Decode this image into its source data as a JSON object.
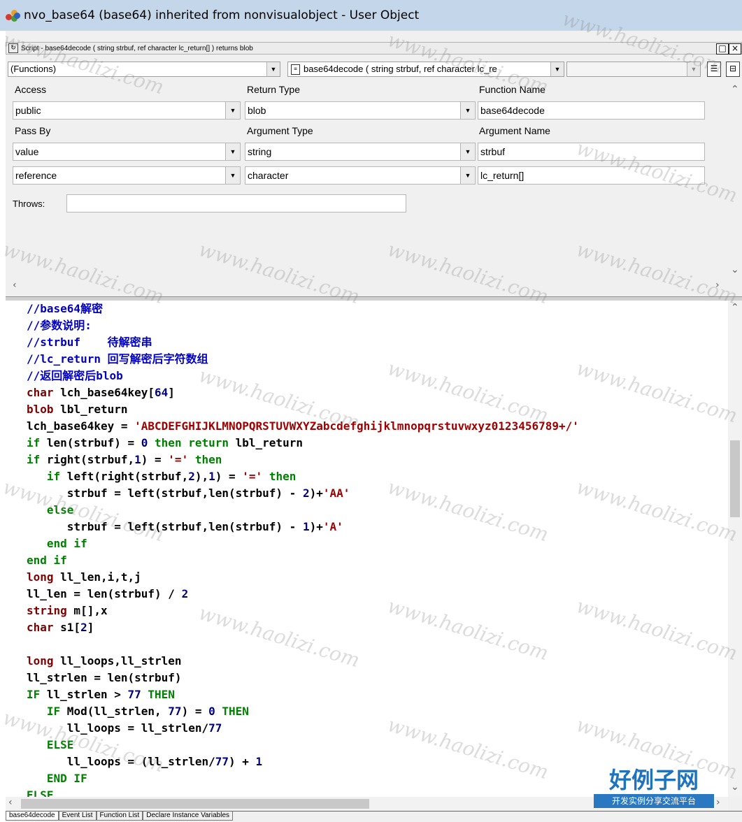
{
  "window": {
    "title": "nvo_base64 (base64) inherited from nonvisualobject - User Object"
  },
  "script_window": {
    "title": "Script - base64decode ( string strbuf, ref character lc_return[] ) returns blob",
    "minimize_label": "□",
    "close_label": "×"
  },
  "toolbar": {
    "category_value": "(Functions)",
    "function_value": "base64decode ( string strbuf, ref character lc_re",
    "third_value": ""
  },
  "prototype": {
    "access_label": "Access",
    "return_type_label": "Return Type",
    "function_name_label": "Function Name",
    "access_value": "public",
    "return_type_value": "blob",
    "function_name_value": "base64decode",
    "pass_by_label": "Pass By",
    "argument_type_label": "Argument Type",
    "argument_name_label": "Argument Name",
    "args": [
      {
        "pass_by": "value",
        "type": "string",
        "name": "strbuf"
      },
      {
        "pass_by": "reference",
        "type": "character",
        "name": "lc_return[]"
      }
    ],
    "throws_label": "Throws:",
    "throws_value": ""
  },
  "code": {
    "line1": "//base64解密",
    "line2": "//参数说明:",
    "line3": "//strbuf    待解密串",
    "line4": "//lc_return 回写解密后字符数组",
    "line5": "//返回解密后blob",
    "l6_kw": "char",
    "l6_rest": " lch_base64key[",
    "l6_num": "64",
    "l6_end": "]",
    "l7_kw": "blob",
    "l7_rest": " lbl_return",
    "l8_pre": "lch_base64key = ",
    "l8_str": "'ABCDEFGHIJKLMNOPQRSTUVWXYZabcdefghijklmnopqrstuvwxyz0123456789+/'",
    "l9_a": "if",
    "l9_b": " len(strbuf) = ",
    "l9_c": "0",
    "l9_d": " then return",
    "l9_e": " lbl_return",
    "l10_a": "if",
    "l10_b": " right(strbuf,",
    "l10_c": "1",
    "l10_d": ") = ",
    "l10_e": "'='",
    "l10_f": " then",
    "l11_a": "   if",
    "l11_b": " left(right(strbuf,",
    "l11_c": "2",
    "l11_d": "),",
    "l11_e": "1",
    "l11_f": ") = ",
    "l11_g": "'='",
    "l11_h": " then",
    "l12_a": "      strbuf = left(strbuf,len(strbuf) - ",
    "l12_b": "2",
    "l12_c": ")+",
    "l12_d": "'AA'",
    "l13_a": "   else",
    "l14_a": "      strbuf = left(strbuf,len(strbuf) - ",
    "l14_b": "1",
    "l14_c": ")+",
    "l14_d": "'A'",
    "l15_a": "   end if",
    "l16_a": "end if",
    "l17_a": "long",
    "l17_b": " ll_len,i,t,j",
    "l18_a": "ll_len = len(strbuf) / ",
    "l18_b": "2",
    "l19_a": "string",
    "l19_b": " m[],x",
    "l20_a": "char",
    "l20_b": " s1[",
    "l20_c": "2",
    "l20_d": "]",
    "l22_a": "long",
    "l22_b": " ll_loops,ll_strlen",
    "l23_a": "ll_strlen = len(strbuf)",
    "l24_a": "IF",
    "l24_b": " ll_strlen > ",
    "l24_c": "77",
    "l24_d": " THEN",
    "l25_a": "   IF",
    "l25_b": " Mod(ll_strlen, ",
    "l25_c": "77",
    "l25_d": ") = ",
    "l25_e": "0",
    "l25_f": " THEN",
    "l26_a": "      ll_loops = ll_strlen/",
    "l26_b": "77",
    "l27_a": "   ELSE",
    "l28_a": "      ll_loops = (ll_strlen/",
    "l28_b": "77",
    "l28_c": ") + ",
    "l28_d": "1",
    "l29_a": "   END IF",
    "l30_a": "ELSE"
  },
  "tabs": [
    "base64decode",
    "Event List",
    "Function List",
    "Declare Instance Variables"
  ],
  "watermark": "www.haolizi.com",
  "brand": {
    "name": "好例子网",
    "slogan": "开发实例分享交流平台"
  },
  "colors": {
    "comment": "#0000c8",
    "keyword": "#008000",
    "type": "#800000",
    "number": "#000080",
    "string": "#a00000"
  }
}
